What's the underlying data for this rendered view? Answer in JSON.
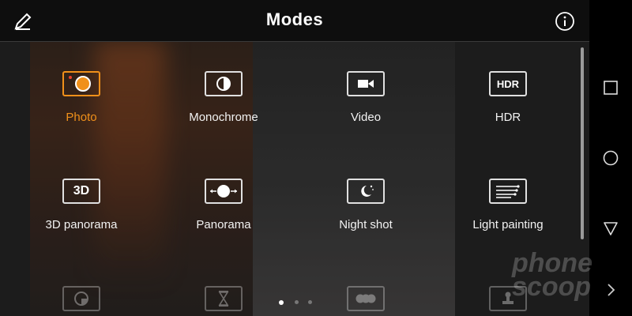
{
  "header": {
    "title": "Modes"
  },
  "modes": [
    {
      "label": "Photo",
      "icon": "photo-icon",
      "active": true
    },
    {
      "label": "Monochrome",
      "icon": "monochrome-icon",
      "active": false
    },
    {
      "label": "Video",
      "icon": "video-icon",
      "active": false
    },
    {
      "label": "HDR",
      "icon": "hdr-icon",
      "box_text": "HDR",
      "active": false
    },
    {
      "label": "3D panorama",
      "icon": "3d-panorama-icon",
      "box_text": "3D",
      "active": false
    },
    {
      "label": "Panorama",
      "icon": "panorama-icon",
      "active": false
    },
    {
      "label": "Night shot",
      "icon": "night-shot-icon",
      "active": false
    },
    {
      "label": "Light painting",
      "icon": "light-painting-icon",
      "active": false
    }
  ],
  "partial_row_icons": [
    "aperture-icon",
    "time-lapse-icon",
    "filter-icon",
    "stamp-icon"
  ],
  "pagination": {
    "pages": 3,
    "current": 1
  },
  "nav": [
    "square-nav-icon",
    "circle-nav-icon",
    "triangle-nav-icon",
    "chevron-right-icon"
  ],
  "watermark": {
    "line1": "phone",
    "line2": "scoop"
  },
  "colors": {
    "accent": "#f0901a",
    "topbar": "#0e0e0e",
    "text": "#ffffff"
  }
}
